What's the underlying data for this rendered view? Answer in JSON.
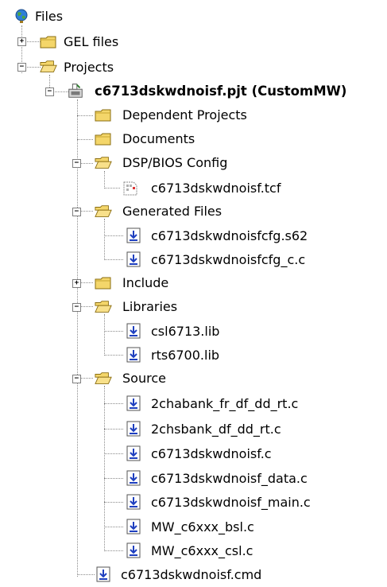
{
  "tree": {
    "root_label": "Files",
    "gel_files_label": "GEL files",
    "projects_label": "Projects",
    "project": {
      "label": "c6713dskwdnoisf.pjt (CustomMW)",
      "dependent_projects_label": "Dependent Projects",
      "documents_label": "Documents",
      "dspbios": {
        "label": "DSP/BIOS Config",
        "files": [
          "c6713dskwdnoisf.tcf"
        ]
      },
      "generated": {
        "label": "Generated Files",
        "files": [
          "c6713dskwdnoisfcfg.s62",
          "c6713dskwdnoisfcfg_c.c"
        ]
      },
      "include_label": "Include",
      "libraries": {
        "label": "Libraries",
        "files": [
          "csl6713.lib",
          "rts6700.lib"
        ]
      },
      "source": {
        "label": "Source",
        "files": [
          "2chabank_fr_df_dd_rt.c",
          "2chsbank_df_dd_rt.c",
          "c6713dskwdnoisf.c",
          "c6713dskwdnoisf_data.c",
          "c6713dskwdnoisf_main.c",
          "MW_c6xxx_bsl.c",
          "MW_c6xxx_csl.c"
        ]
      },
      "cmd_file_label": "c6713dskwdnoisf.cmd"
    }
  },
  "colors": {
    "folder_fill": "#f4d66a",
    "folder_edge": "#8a6d10",
    "tree_line": "#8a8a8a",
    "file_arrow": "#1e3fbf"
  },
  "icons": {
    "root": "globe-icon",
    "folder_closed": "folder-icon",
    "folder_open": "folder-open-icon",
    "project": "project-icon",
    "source_file": "source-file-icon",
    "config_file": "config-file-icon"
  }
}
